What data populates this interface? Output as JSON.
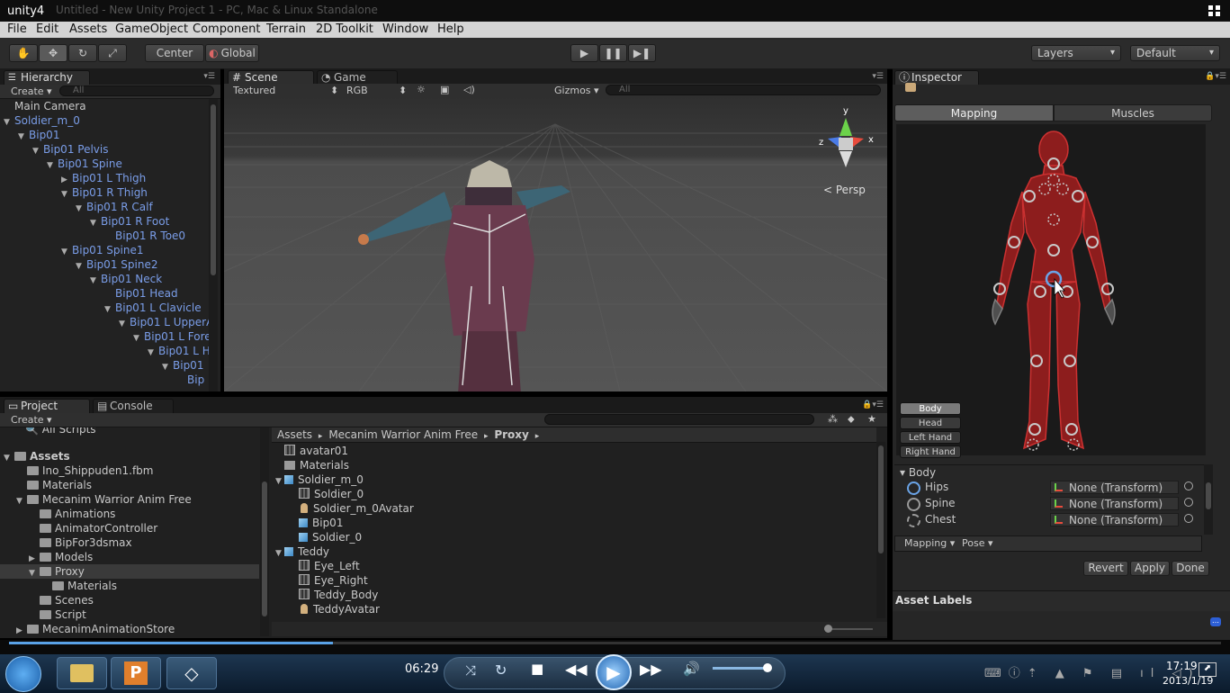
{
  "window": {
    "title": "unity4",
    "faded_title": "Untitled - New Unity Project 1 - PC, Mac & Linux Standalone"
  },
  "menu": [
    "File",
    "Edit",
    "Assets",
    "GameObject",
    "Component",
    "Terrain",
    "2D Toolkit",
    "Window",
    "Help"
  ],
  "toolbar": {
    "center": "Center",
    "global": "Global",
    "layers": "Layers",
    "layout": "Default"
  },
  "hierarchy": {
    "tab": "Hierarchy",
    "create": "Create",
    "search_placeholder": "All",
    "items": [
      {
        "label": "Main Camera",
        "depth": 0,
        "expander": "",
        "blue": false
      },
      {
        "label": "Soldier_m_0",
        "depth": 0,
        "expander": "down",
        "blue": true
      },
      {
        "label": "Bip01",
        "depth": 1,
        "expander": "down",
        "blue": true
      },
      {
        "label": "Bip01 Pelvis",
        "depth": 2,
        "expander": "down",
        "blue": true
      },
      {
        "label": "Bip01 Spine",
        "depth": 3,
        "expander": "down",
        "blue": true
      },
      {
        "label": "Bip01 L Thigh",
        "depth": 4,
        "expander": "right",
        "blue": true
      },
      {
        "label": "Bip01 R Thigh",
        "depth": 4,
        "expander": "down",
        "blue": true
      },
      {
        "label": "Bip01 R Calf",
        "depth": 5,
        "expander": "down",
        "blue": true
      },
      {
        "label": "Bip01 R Foot",
        "depth": 6,
        "expander": "down",
        "blue": true
      },
      {
        "label": "Bip01 R Toe0",
        "depth": 7,
        "expander": "",
        "blue": true
      },
      {
        "label": "Bip01 Spine1",
        "depth": 4,
        "expander": "down",
        "blue": true
      },
      {
        "label": "Bip01 Spine2",
        "depth": 5,
        "expander": "down",
        "blue": true
      },
      {
        "label": "Bip01 Neck",
        "depth": 6,
        "expander": "down",
        "blue": true
      },
      {
        "label": "Bip01 Head",
        "depth": 7,
        "expander": "",
        "blue": true
      },
      {
        "label": "Bip01 L Clavicle",
        "depth": 7,
        "expander": "down",
        "blue": true
      },
      {
        "label": "Bip01 L UpperA",
        "depth": 8,
        "expander": "down",
        "blue": true
      },
      {
        "label": "Bip01 L Fore",
        "depth": 9,
        "expander": "down",
        "blue": true
      },
      {
        "label": "Bip01 L H",
        "depth": 10,
        "expander": "down",
        "blue": true
      },
      {
        "label": "Bip01",
        "depth": 11,
        "expander": "down",
        "blue": true
      },
      {
        "label": "Bip",
        "depth": 12,
        "expander": "",
        "blue": true
      }
    ]
  },
  "scene": {
    "tab_scene": "Scene",
    "tab_game": "Game",
    "shading": "Textured",
    "render": "RGB",
    "gizmos": "Gizmos",
    "search_placeholder": "All",
    "persp": "Persp",
    "axis_y": "y",
    "axis_x": "x",
    "axis_z": "z"
  },
  "project": {
    "tab_project": "Project",
    "tab_console": "Console",
    "create": "Create",
    "all_scripts": "All Scripts",
    "tree": [
      {
        "label": "Assets",
        "depth": 0,
        "expander": "down",
        "bold": true
      },
      {
        "label": "Ino_Shippuden1.fbm",
        "depth": 1,
        "expander": ""
      },
      {
        "label": "Materials",
        "depth": 1,
        "expander": ""
      },
      {
        "label": "Mecanim Warrior Anim Free",
        "depth": 1,
        "expander": "down"
      },
      {
        "label": "Animations",
        "depth": 2,
        "expander": ""
      },
      {
        "label": "AnimatorController",
        "depth": 2,
        "expander": ""
      },
      {
        "label": "BipFor3dsmax",
        "depth": 2,
        "expander": ""
      },
      {
        "label": "Models",
        "depth": 2,
        "expander": "right"
      },
      {
        "label": "Proxy",
        "depth": 2,
        "expander": "down",
        "selected": true
      },
      {
        "label": "Materials",
        "depth": 3,
        "expander": ""
      },
      {
        "label": "Scenes",
        "depth": 2,
        "expander": ""
      },
      {
        "label": "Script",
        "depth": 2,
        "expander": ""
      },
      {
        "label": "MecanimAnimationStore",
        "depth": 1,
        "expander": "right"
      }
    ],
    "breadcrumb": [
      "Assets",
      "Mecanim Warrior Anim Free",
      "Proxy"
    ],
    "files": [
      {
        "label": "avatar01",
        "depth": 0,
        "expander": "",
        "icon": "grid"
      },
      {
        "label": "Materials",
        "depth": 0,
        "expander": "",
        "icon": "folder"
      },
      {
        "label": "Soldier_m_0",
        "depth": 0,
        "expander": "down",
        "icon": "model"
      },
      {
        "label": "Soldier_0",
        "depth": 1,
        "expander": "",
        "icon": "grid"
      },
      {
        "label": "Soldier_m_0Avatar",
        "depth": 1,
        "expander": "",
        "icon": "avatar"
      },
      {
        "label": "Bip01",
        "depth": 1,
        "expander": "",
        "icon": "model"
      },
      {
        "label": "Soldier_0",
        "depth": 1,
        "expander": "",
        "icon": "model"
      },
      {
        "label": "Teddy",
        "depth": 0,
        "expander": "down",
        "icon": "model"
      },
      {
        "label": "Eye_Left",
        "depth": 1,
        "expander": "",
        "icon": "grid"
      },
      {
        "label": "Eye_Right",
        "depth": 1,
        "expander": "",
        "icon": "grid"
      },
      {
        "label": "Teddy_Body",
        "depth": 1,
        "expander": "",
        "icon": "grid"
      },
      {
        "label": "TeddyAvatar",
        "depth": 1,
        "expander": "",
        "icon": "avatar"
      }
    ]
  },
  "inspector": {
    "tab": "Inspector",
    "mapping": "Mapping",
    "muscles": "Muscles",
    "body_buttons": [
      "Body",
      "Head",
      "Left Hand",
      "Right Hand"
    ],
    "section": "Body",
    "joints": [
      {
        "name": "Hips",
        "value": "None (Transform)"
      },
      {
        "name": "Spine",
        "value": "None (Transform)"
      },
      {
        "name": "Chest",
        "value": "None (Transform)"
      }
    ],
    "mapping_menu": "Mapping",
    "pose_menu": "Pose",
    "revert": "Revert",
    "apply": "Apply",
    "done": "Done",
    "asset_labels": "Asset Labels"
  },
  "media": {
    "time": "06:29",
    "progress": 0.267
  },
  "taskbar": {
    "clock_time": "17:19",
    "clock_date": "2013/1/19"
  }
}
